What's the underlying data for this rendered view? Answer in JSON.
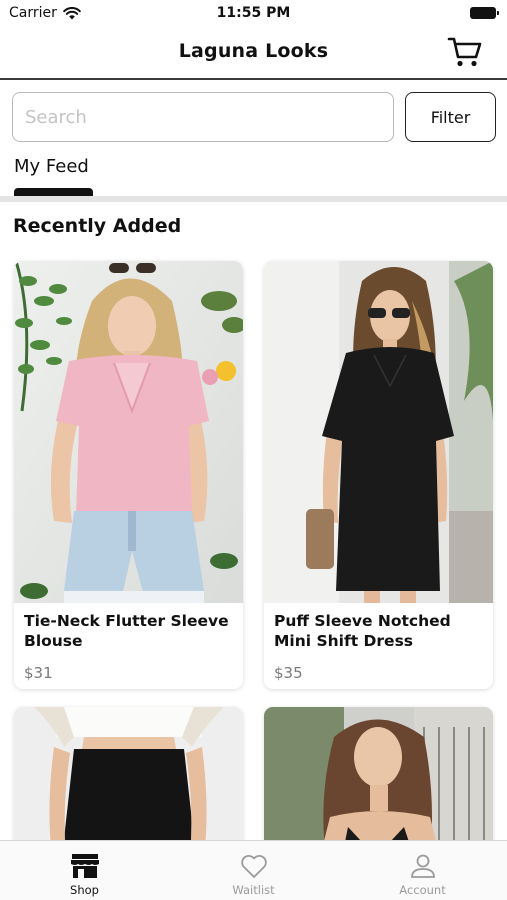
{
  "status_bar": {
    "carrier": "Carrier",
    "time": "11:55 PM"
  },
  "header": {
    "title": "Laguna Looks",
    "cart_icon": "cart-icon"
  },
  "search": {
    "placeholder": "Search",
    "value": "",
    "filter_label": "Filter"
  },
  "tabs": {
    "active": "My Feed"
  },
  "section": {
    "title": "Recently Added"
  },
  "products": [
    {
      "name": "Tie-Neck Flutter Sleeve Blouse",
      "price": "$31"
    },
    {
      "name": "Puff Sleeve Notched Mini Shift Dress",
      "price": "$35"
    }
  ],
  "tab_bar": {
    "items": [
      {
        "label": "Shop",
        "icon": "store-icon",
        "active": true
      },
      {
        "label": "Waitlist",
        "icon": "heart-icon",
        "active": false
      },
      {
        "label": "Account",
        "icon": "person-icon",
        "active": false
      }
    ]
  },
  "colors": {
    "accent": "#111111",
    "inactive": "#9a9a9a",
    "price": "#7a7a7a",
    "divider": "#e4e4e4"
  }
}
